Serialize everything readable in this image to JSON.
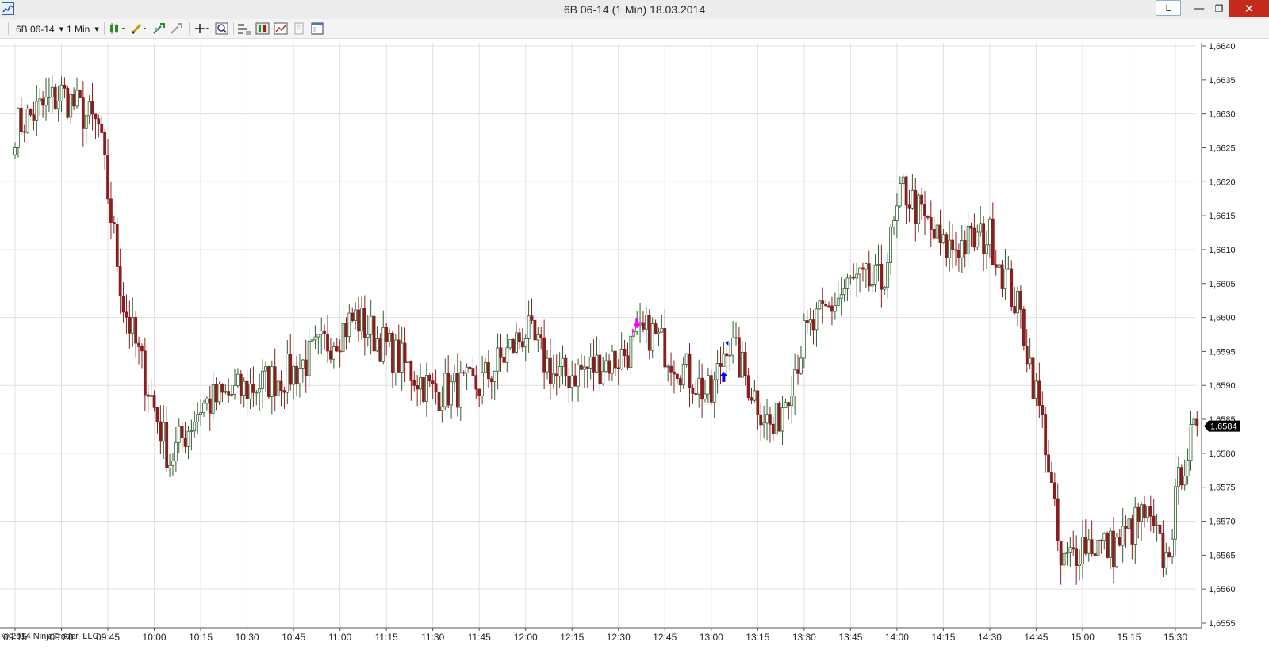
{
  "window": {
    "title": "6B 06-14 (1 Min)  18.03.2014",
    "link_button_label": "L",
    "minimize_glyph": "—",
    "maximize_glyph": "❐",
    "close_glyph": "✕"
  },
  "toolbar": {
    "instrument": "6B 06-14",
    "interval": "1 Min",
    "icons": [
      "bar-type-icon",
      "drawing-tool-icon",
      "indicator-icon",
      "strategy-icon",
      "crosshair-icon",
      "zoom-icon",
      "properties-icon",
      "chart-style-icon",
      "data-series-icon",
      "template-icon",
      "panel-icon"
    ]
  },
  "copyright": "© 2014 NinjaTrader, LLC",
  "colors": {
    "up_candle": "#2f5f2f",
    "down_candle": "#8a1e1e",
    "up_fill": "#ffffff",
    "grid": "#e0e0e0",
    "short_marker": "#ff00ff",
    "long_marker": "#0000ff",
    "price_label_bg": "#000000"
  },
  "chart_data": {
    "type": "candlestick",
    "title": "",
    "xlabel": "",
    "ylabel": "",
    "ylim": [
      1.6555,
      1.664
    ],
    "y_ticks": [
      "1,6555",
      "1,6560",
      "1,6565",
      "1,6570",
      "1,6575",
      "1,6580",
      "1,6585",
      "1,6590",
      "1,6595",
      "1,6600",
      "1,6605",
      "1,6610",
      "1,6615",
      "1,6620",
      "1,6625",
      "1,6630",
      "1,6635",
      "1,6640"
    ],
    "x_ticks": [
      "09:15",
      "09:30",
      "09:45",
      "10:00",
      "10:15",
      "10:30",
      "10:45",
      "11:00",
      "11:15",
      "11:30",
      "11:45",
      "12:00",
      "12:15",
      "12:30",
      "12:45",
      "13:00",
      "13:15",
      "13:30",
      "13:45",
      "14:00",
      "14:15",
      "14:30",
      "14:45",
      "15:00",
      "15:15",
      "15:30"
    ],
    "last_price": "1,6584",
    "grid": true,
    "markers": [
      {
        "type": "short-entry-arrow",
        "time": "12:36",
        "price": 1.65985
      },
      {
        "type": "long-entry-arrow",
        "time": "13:04",
        "price": 1.65925
      }
    ],
    "key_points": [
      {
        "time": "09:15",
        "price": 1.6628
      },
      {
        "time": "09:30",
        "price": 1.6633
      },
      {
        "time": "09:42",
        "price": 1.6628
      },
      {
        "time": "09:50",
        "price": 1.6602
      },
      {
        "time": "10:05",
        "price": 1.6579
      },
      {
        "time": "10:15",
        "price": 1.6587
      },
      {
        "time": "10:45",
        "price": 1.6592
      },
      {
        "time": "11:05",
        "price": 1.66
      },
      {
        "time": "11:30",
        "price": 1.6589
      },
      {
        "time": "11:45",
        "price": 1.659
      },
      {
        "time": "12:00",
        "price": 1.6598
      },
      {
        "time": "12:10",
        "price": 1.6591
      },
      {
        "time": "12:30",
        "price": 1.6594
      },
      {
        "time": "12:40",
        "price": 1.6598
      },
      {
        "time": "13:00",
        "price": 1.6588
      },
      {
        "time": "13:05",
        "price": 1.6597
      },
      {
        "time": "13:20",
        "price": 1.6583
      },
      {
        "time": "13:30",
        "price": 1.6597
      },
      {
        "time": "13:45",
        "price": 1.6605
      },
      {
        "time": "13:55",
        "price": 1.6605
      },
      {
        "time": "14:02",
        "price": 1.6619
      },
      {
        "time": "14:15",
        "price": 1.661
      },
      {
        "time": "14:30",
        "price": 1.6612
      },
      {
        "time": "14:40",
        "price": 1.66
      },
      {
        "time": "14:48",
        "price": 1.6582
      },
      {
        "time": "14:53",
        "price": 1.6563
      },
      {
        "time": "15:00",
        "price": 1.6567
      },
      {
        "time": "15:10",
        "price": 1.6566
      },
      {
        "time": "15:20",
        "price": 1.6571
      },
      {
        "time": "15:27",
        "price": 1.6564
      },
      {
        "time": "15:32",
        "price": 1.6578
      },
      {
        "time": "15:37",
        "price": 1.6584
      }
    ]
  }
}
